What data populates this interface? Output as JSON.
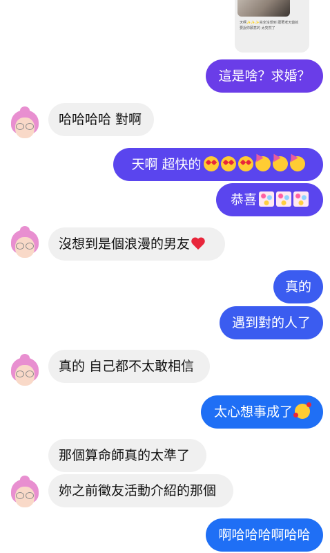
{
  "shared_post": {
    "caption": "天啊✨✨✨完全沒想到 跟著老天爺就要說你願意的 太突然了"
  },
  "messages": [
    {
      "text": "這是啥？求婚？",
      "emoji": []
    },
    {
      "text": "哈哈哈哈 對啊",
      "emoji": []
    },
    {
      "text": "天啊 超快的",
      "emoji": [
        "heart-eyes-icon",
        "heart-eyes-icon",
        "heart-eyes-icon",
        "party-face-icon",
        "party-face-icon",
        "party-face-icon"
      ]
    },
    {
      "text": "恭喜",
      "emoji": [
        "confetti-icon",
        "confetti-icon",
        "confetti-icon"
      ]
    },
    {
      "text": "沒想到是個浪漫的男友",
      "emoji": [
        "red-heart-icon"
      ]
    },
    {
      "text": "真的",
      "emoji": []
    },
    {
      "text": "遇到對的人了",
      "emoji": []
    },
    {
      "text": "真的 自己都不太敢相信",
      "emoji": []
    },
    {
      "text": "太心想事成了",
      "emoji": [
        "smiling-face-with-hearts-icon"
      ]
    },
    {
      "text": "那個算命師真的太準了",
      "emoji": []
    },
    {
      "text": "妳之前徵友活動介紹的那個",
      "emoji": []
    },
    {
      "text": "啊哈哈哈啊哈哈",
      "emoji": []
    }
  ],
  "colors": {
    "incoming_bubble": "#f0f0f0",
    "outgoing_purple": "#6a3de8",
    "outgoing_violet": "#5a45ee",
    "outgoing_blue": "#3b5cf0",
    "outgoing_bright_blue": "#1f6ff5",
    "avatar_hair": "#e88fd0"
  }
}
